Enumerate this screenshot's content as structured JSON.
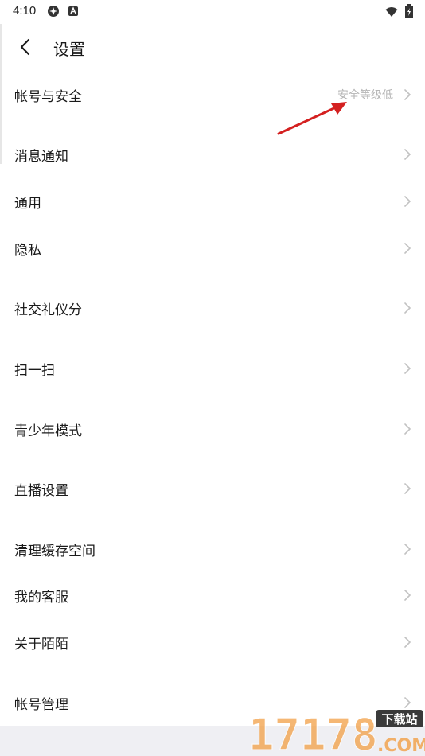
{
  "status": {
    "time": "4:10"
  },
  "header": {
    "title": "设置"
  },
  "items": [
    {
      "label": "帐号与安全",
      "sub": "安全等级低"
    },
    {
      "label": "消息通知"
    },
    {
      "label": "通用"
    },
    {
      "label": "隐私"
    },
    {
      "label": "社交礼仪分"
    },
    {
      "label": "扫一扫"
    },
    {
      "label": "青少年模式"
    },
    {
      "label": "直播设置"
    },
    {
      "label": "清理缓存空间"
    },
    {
      "label": "我的客服"
    },
    {
      "label": "关于陌陌"
    },
    {
      "label": "帐号管理"
    }
  ],
  "watermark": {
    "number": "17178",
    "tag": "下载站",
    "domain": ".COM"
  },
  "colors": {
    "arrow": "#d42020",
    "secondary_text": "#b5b5b5",
    "chevron": "#c2c2c2",
    "watermark_orange": "#f29a3a"
  }
}
